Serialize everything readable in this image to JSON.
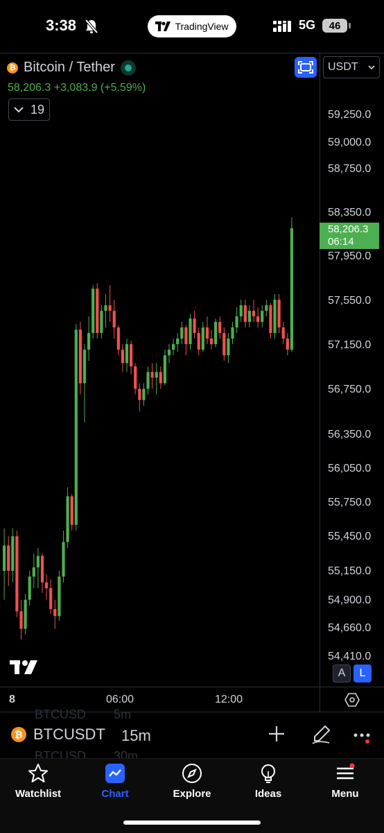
{
  "status_bar": {
    "time": "3:38",
    "network": "5G",
    "battery": "46",
    "app_badge": "TradingView"
  },
  "symbol": {
    "title": "Bitcoin / Tether",
    "last": "58,206.3",
    "change": "+3,083.9",
    "change_pct": "(+5.59%)",
    "indicator_count": "19",
    "currency": "USDT"
  },
  "price_axis": {
    "ticks": [
      "59,250.0",
      "59,000.0",
      "58,750.0",
      "58,350.0",
      "57,950.0",
      "57,550.0",
      "57,150.0",
      "56,750.0",
      "56,350.0",
      "56,050.0",
      "55,750.0",
      "55,450.0",
      "55,150.0",
      "54,900.0",
      "54,660.0",
      "54,410.0"
    ],
    "last_price": "58,206.3",
    "countdown": "06:14",
    "auto_label": "A",
    "log_label": "L"
  },
  "time_axis": {
    "ticks": [
      "8",
      "06:00",
      "12:00"
    ]
  },
  "symbol_bar": {
    "ticker": "BTCUSDT",
    "interval": "15m",
    "ghost_above": {
      "ticker": "BTCUSD",
      "interval": "5m"
    },
    "ghost_below": {
      "ticker": "BTCUSD",
      "interval": "30m"
    }
  },
  "tabs": [
    {
      "label": "Watchlist",
      "icon": "star-icon"
    },
    {
      "label": "Chart",
      "icon": "chart-icon",
      "active": true
    },
    {
      "label": "Explore",
      "icon": "compass-icon"
    },
    {
      "label": "Ideas",
      "icon": "lightbulb-icon"
    },
    {
      "label": "Menu",
      "icon": "menu-icon"
    }
  ],
  "colors": {
    "up": "#4caf50",
    "down": "#f0504f",
    "accent": "#2962ff",
    "axis": "#2a2e39"
  },
  "chart_data": {
    "type": "candlestick",
    "symbol": "BTCUSDT",
    "interval": "15m",
    "y_scale": "log",
    "ylim": [
      54410,
      59250
    ],
    "candles": [
      [
        55150,
        55520,
        54900,
        55370
      ],
      [
        55370,
        55450,
        55020,
        55150
      ],
      [
        55150,
        55520,
        55050,
        55450
      ],
      [
        55450,
        55500,
        54750,
        54800
      ],
      [
        54800,
        54900,
        54560,
        54650
      ],
      [
        54650,
        54950,
        54600,
        54900
      ],
      [
        54900,
        55150,
        54850,
        55100
      ],
      [
        55100,
        55300,
        55000,
        55180
      ],
      [
        55180,
        55350,
        55000,
        55280
      ],
      [
        55280,
        55300,
        54960,
        55050
      ],
      [
        55050,
        55120,
        54900,
        55000
      ],
      [
        55000,
        55080,
        54780,
        54820
      ],
      [
        54820,
        54900,
        54650,
        54760
      ],
      [
        54760,
        55150,
        54720,
        55100
      ],
      [
        55100,
        55500,
        55050,
        55400
      ],
      [
        55400,
        55880,
        55350,
        55800
      ],
      [
        55800,
        55820,
        55500,
        55550
      ],
      [
        55550,
        57330,
        55500,
        57280
      ],
      [
        57280,
        57350,
        56700,
        56800
      ],
      [
        56800,
        57150,
        56450,
        57100
      ],
      [
        57100,
        57400,
        57000,
        57250
      ],
      [
        57250,
        57680,
        57200,
        57650
      ],
      [
        57650,
        57700,
        57200,
        57250
      ],
      [
        57250,
        57500,
        57200,
        57450
      ],
      [
        57450,
        57600,
        57300,
        57500
      ],
      [
        57500,
        57680,
        57350,
        57450
      ],
      [
        57450,
        57550,
        57200,
        57300
      ],
      [
        57300,
        57320,
        57050,
        57100
      ],
      [
        57100,
        57150,
        56900,
        56980
      ],
      [
        56980,
        57200,
        56900,
        57150
      ],
      [
        57150,
        57180,
        56880,
        56950
      ],
      [
        56950,
        56980,
        56700,
        56750
      ],
      [
        56750,
        56800,
        56550,
        56650
      ],
      [
        56650,
        56800,
        56600,
        56750
      ],
      [
        56750,
        56950,
        56700,
        56900
      ],
      [
        56900,
        56980,
        56750,
        56850
      ],
      [
        56850,
        56980,
        56700,
        56900
      ],
      [
        56900,
        56950,
        56750,
        56800
      ],
      [
        56800,
        57100,
        56780,
        57050
      ],
      [
        57050,
        57150,
        56980,
        57100
      ],
      [
        57100,
        57200,
        57050,
        57150
      ],
      [
        57150,
        57250,
        57080,
        57200
      ],
      [
        57200,
        57350,
        57150,
        57300
      ],
      [
        57300,
        57320,
        57050,
        57150
      ],
      [
        57150,
        57420,
        57100,
        57380
      ],
      [
        57380,
        57450,
        57200,
        57250
      ],
      [
        57250,
        57300,
        57050,
        57100
      ],
      [
        57100,
        57350,
        57080,
        57300
      ],
      [
        57300,
        57400,
        57150,
        57200
      ],
      [
        57200,
        57280,
        57100,
        57150
      ],
      [
        57150,
        57380,
        57120,
        57350
      ],
      [
        57350,
        57400,
        57200,
        57250
      ],
      [
        57250,
        57300,
        57000,
        57050
      ],
      [
        57050,
        57250,
        56980,
        57200
      ],
      [
        57200,
        57350,
        57150,
        57300
      ],
      [
        57300,
        57480,
        57250,
        57400
      ],
      [
        57400,
        57550,
        57350,
        57500
      ],
      [
        57500,
        57550,
        57300,
        57350
      ],
      [
        57350,
        57500,
        57300,
        57450
      ],
      [
        57450,
        57550,
        57350,
        57400
      ],
      [
        57400,
        57480,
        57300,
        57350
      ],
      [
        57350,
        57500,
        57300,
        57450
      ],
      [
        57450,
        57550,
        57400,
        57500
      ],
      [
        57500,
        57520,
        57200,
        57250
      ],
      [
        57250,
        57600,
        57200,
        57550
      ],
      [
        57550,
        57600,
        57250,
        57300
      ],
      [
        57300,
        57350,
        57150,
        57200
      ],
      [
        57200,
        57250,
        57050,
        57100
      ],
      [
        57100,
        58300,
        57080,
        58200
      ]
    ]
  }
}
